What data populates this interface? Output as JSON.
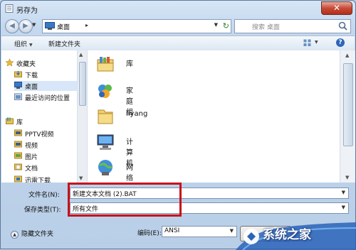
{
  "window": {
    "title": "另存为",
    "close_label": "✕"
  },
  "address_bar": {
    "location": "桌面",
    "chevron": "▸",
    "back_label": "◀",
    "forward_label": "▶",
    "refresh": "↻"
  },
  "search": {
    "placeholder": "搜索 桌面"
  },
  "toolbar": {
    "organize": "组织",
    "new_folder": "新建文件夹",
    "help": "?"
  },
  "nav_pane": {
    "favorites": "收藏夹",
    "items": [
      "下载",
      "桌面",
      "最近访问的位置"
    ],
    "library": "库",
    "library_items": [
      "PPTV视频",
      "视频",
      "图片",
      "文档",
      "迅雷下载"
    ]
  },
  "files": [
    {
      "name": "库",
      "icon": "library-icon"
    },
    {
      "name": "家庭组",
      "icon": "homegroup-icon"
    },
    {
      "name": "liyang",
      "icon": "user-folder-icon"
    },
    {
      "name": "计算机",
      "icon": "computer-icon"
    },
    {
      "name": "网络",
      "icon": "network-icon"
    }
  ],
  "form": {
    "filename_label": "文件名(N):",
    "filename_value": "新建文本文档 (2).BAT",
    "savetype_label": "保存类型(T):",
    "savetype_value": "所有文件",
    "hide_folders": "隐藏文件夹",
    "encoding_label": "编码(E):",
    "encoding_value": "ANSI"
  },
  "watermark": {
    "text": "系统之家"
  },
  "colors": {
    "highlight": "#c8101a",
    "close": "#c74a38",
    "window_bg": "#c3d7ee"
  }
}
